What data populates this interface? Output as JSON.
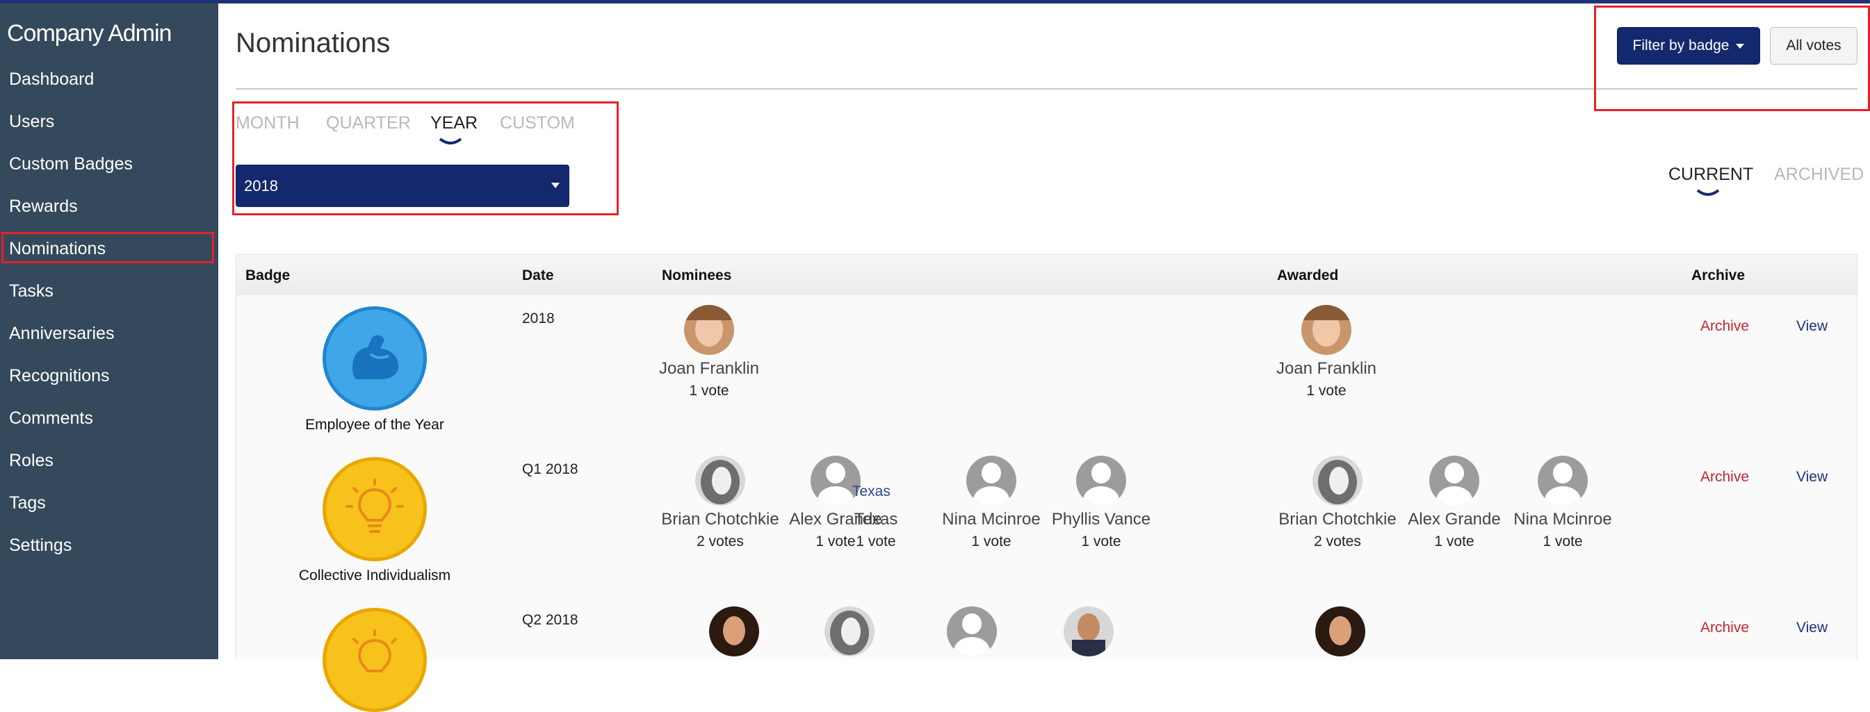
{
  "app": {
    "title": "Company Admin"
  },
  "sidebar": {
    "items": [
      {
        "label": "Dashboard"
      },
      {
        "label": "Users"
      },
      {
        "label": "Custom Badges"
      },
      {
        "label": "Rewards"
      },
      {
        "label": "Nominations",
        "active": true
      },
      {
        "label": "Tasks"
      },
      {
        "label": "Anniversaries"
      },
      {
        "label": "Recognitions"
      },
      {
        "label": "Comments"
      },
      {
        "label": "Roles"
      },
      {
        "label": "Tags"
      },
      {
        "label": "Settings"
      }
    ]
  },
  "header": {
    "title": "Nominations",
    "filter_label": "Filter by badge",
    "votes_label": "All votes"
  },
  "period_tabs": [
    "MONTH",
    "QUARTER",
    "YEAR",
    "CUSTOM"
  ],
  "active_period": "YEAR",
  "year_select": {
    "value": "2018"
  },
  "status_tabs": [
    "CURRENT",
    "ARCHIVED"
  ],
  "active_status": "CURRENT",
  "table": {
    "headers": {
      "badge": "Badge",
      "date": "Date",
      "nominees": "Nominees",
      "awarded": "Awarded",
      "archive": "Archive"
    },
    "rows": [
      {
        "badge": "Employee of the Year",
        "badge_icon": "flexed-arm-icon",
        "date": "2018",
        "nominees": [
          {
            "name": "Joan Franklin",
            "votes": "1 vote"
          }
        ],
        "awarded": [
          {
            "name": "Joan Franklin",
            "votes": "1 vote"
          }
        ],
        "archive": "Archive",
        "view": "View"
      },
      {
        "badge": "Collective Individualism",
        "badge_icon": "lightbulb-icon",
        "date": "Q1 2018",
        "nominees": [
          {
            "name": "Brian Chotchkie",
            "votes": "2 votes"
          },
          {
            "name": "Alex Grande",
            "votes": "1 vote"
          },
          {
            "name": "Texas",
            "votes": "1 vote",
            "label": "Texas"
          },
          {
            "name": "Nina Mcinroe",
            "votes": "1 vote"
          },
          {
            "name": "Phyllis Vance",
            "votes": "1 vote"
          }
        ],
        "awarded": [
          {
            "name": "Brian Chotchkie",
            "votes": "2 votes"
          },
          {
            "name": "Alex Grande",
            "votes": "1 vote"
          },
          {
            "name": "Nina Mcinroe",
            "votes": "1 vote"
          }
        ],
        "archive": "Archive",
        "view": "View"
      },
      {
        "badge": "",
        "badge_icon": "lightbulb-icon",
        "date": "Q2 2018",
        "archive": "Archive",
        "view": "View"
      }
    ]
  },
  "colors": {
    "sidebar": "#35495c",
    "primary": "#14286e",
    "archive": "#c1272d",
    "highlight": "#e52228"
  }
}
